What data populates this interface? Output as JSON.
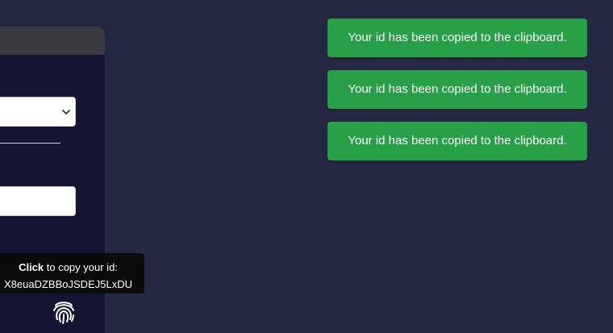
{
  "colors": {
    "background": "#252841",
    "panel": "#131533",
    "panel_header": "#3a3b40",
    "toast_success": "#28a048",
    "tooltip_bg": "#0b0b0c"
  },
  "toasts": [
    {
      "message": "Your id has been copied to the clipboard."
    },
    {
      "message": "Your id has been copied to the clipboard."
    },
    {
      "message": "Your id has been copied to the clipboard."
    }
  ],
  "tooltip": {
    "action_bold": "Click",
    "action_rest": " to copy your id:",
    "id_value": "X8euaDZBBoJSDEJ5LxDU"
  },
  "icons": {
    "select_chevron": "chevron-down-icon",
    "copy_id": "fingerprint-icon"
  }
}
